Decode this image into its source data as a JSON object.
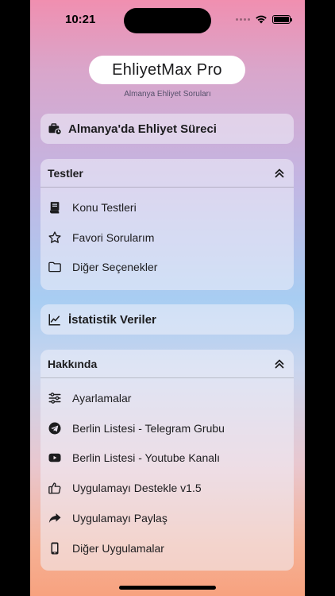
{
  "status_bar": {
    "time": "10:21"
  },
  "header": {
    "title": "EhliyetMax Pro",
    "subtitle": "Almanya Ehliyet Soruları"
  },
  "process_card": {
    "label": "Almanya'da Ehliyet Süreci",
    "icon": "briefcase-clock-icon"
  },
  "tests_section": {
    "title": "Testler",
    "items": [
      {
        "label": "Konu Testleri",
        "icon": "book-icon"
      },
      {
        "label": "Favori Sorularım",
        "icon": "star-icon"
      },
      {
        "label": "Diğer Seçenekler",
        "icon": "folder-icon"
      }
    ]
  },
  "stats_card": {
    "label": "İstatistik Veriler",
    "icon": "chart-line-icon"
  },
  "about_section": {
    "title": "Hakkında",
    "items": [
      {
        "label": "Ayarlamalar",
        "icon": "sliders-icon"
      },
      {
        "label": "Berlin Listesi - Telegram Grubu",
        "icon": "telegram-icon"
      },
      {
        "label": "Berlin Listesi - Youtube Kanalı",
        "icon": "youtube-icon"
      },
      {
        "label": "Uygulamayı Destekle v1.5",
        "icon": "thumbs-up-icon"
      },
      {
        "label": "Uygulamayı Paylaş",
        "icon": "share-icon"
      },
      {
        "label": "Diğer Uygulamalar",
        "icon": "phone-icon"
      }
    ]
  },
  "colors": {
    "gradient_top": "#f08fb0",
    "gradient_mid": "#a8cdf2",
    "gradient_bottom": "#f7a27f",
    "card_bg": "#eeeef8"
  }
}
